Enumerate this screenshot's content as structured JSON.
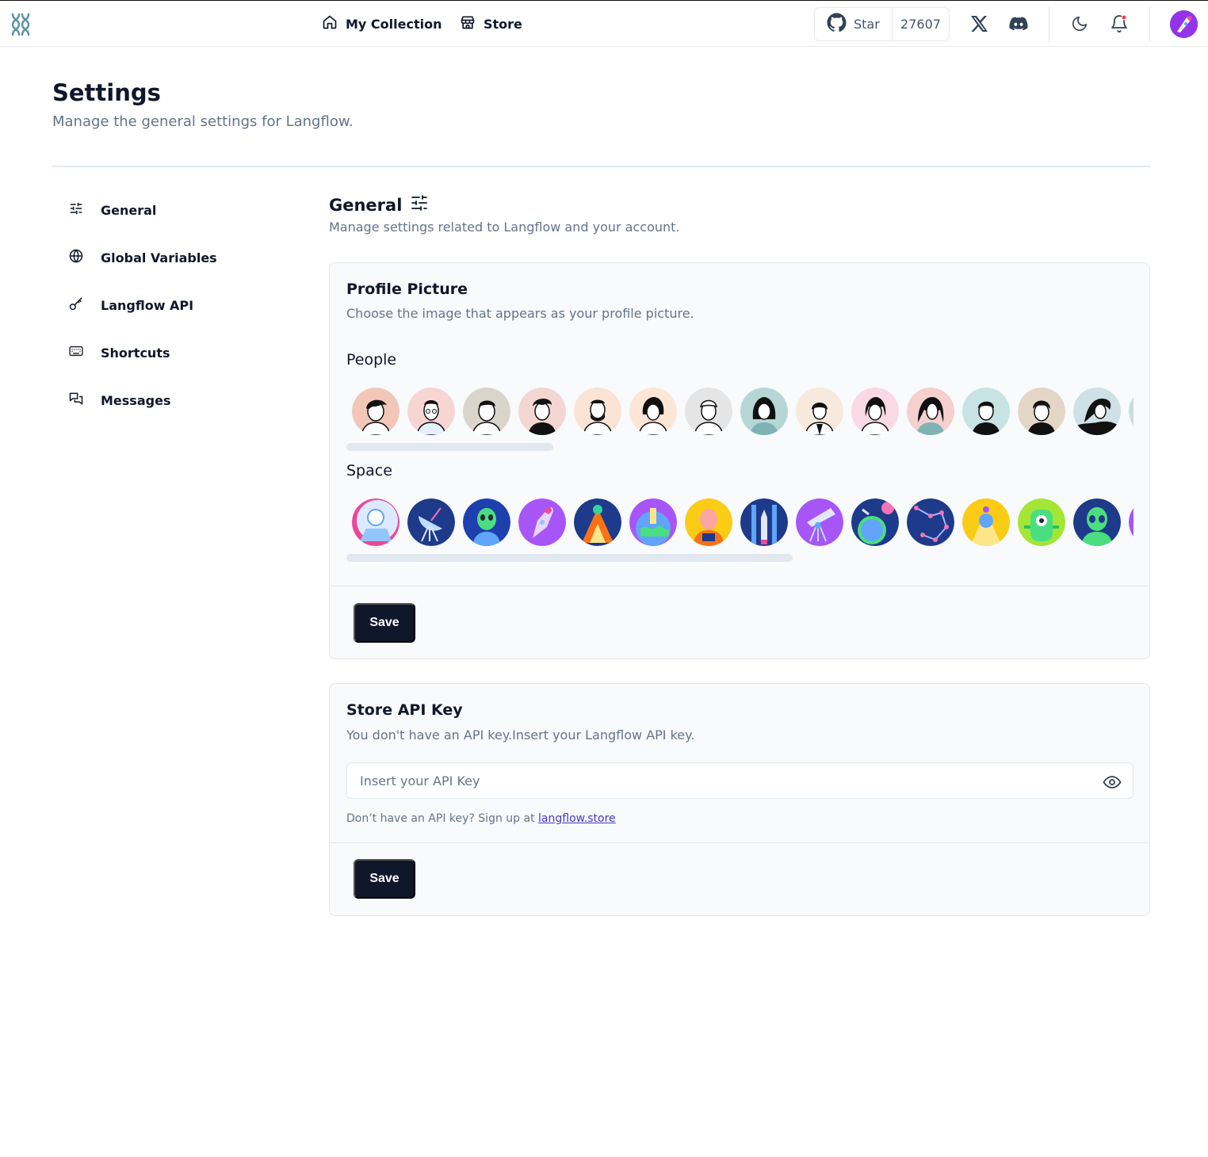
{
  "header": {
    "nav": {
      "collection": "My Collection",
      "store": "Store"
    },
    "github": {
      "star_label": "Star",
      "star_count": "27607"
    },
    "icons": [
      "logo-icon",
      "home-icon",
      "store-icon",
      "github-icon",
      "x-icon",
      "discord-icon",
      "moon-icon",
      "bell-icon",
      "user-avatar"
    ],
    "notification_dot_color": "#ef4444"
  },
  "page": {
    "title": "Settings",
    "subtitle": "Manage the general settings for Langflow."
  },
  "sidebar": {
    "items": [
      {
        "label": "General",
        "icon": "sliders-icon"
      },
      {
        "label": "Global Variables",
        "icon": "globe-icon"
      },
      {
        "label": "Langflow API",
        "icon": "key-icon"
      },
      {
        "label": "Shortcuts",
        "icon": "keyboard-icon"
      },
      {
        "label": "Messages",
        "icon": "messages-icon"
      }
    ]
  },
  "general": {
    "title": "General",
    "subtitle": "Manage settings related to Langflow and your account."
  },
  "profile_picture": {
    "title": "Profile Picture",
    "subtitle": "Choose the image that appears as your profile picture.",
    "people_label": "People",
    "space_label": "Space",
    "save_label": "Save"
  },
  "store_api": {
    "title": "Store API Key",
    "subtitle": "You don't have an API key.Insert your Langflow API key.",
    "input_placeholder": "Insert your API Key",
    "input_value": "",
    "hint_prefix": "Don’t have an API key? Sign up at",
    "hint_link": "langflow.store",
    "save_label": "Save"
  },
  "colors": {
    "primary_button": "#0f172a",
    "muted_text": "#64748b",
    "link": "#4338ca"
  }
}
